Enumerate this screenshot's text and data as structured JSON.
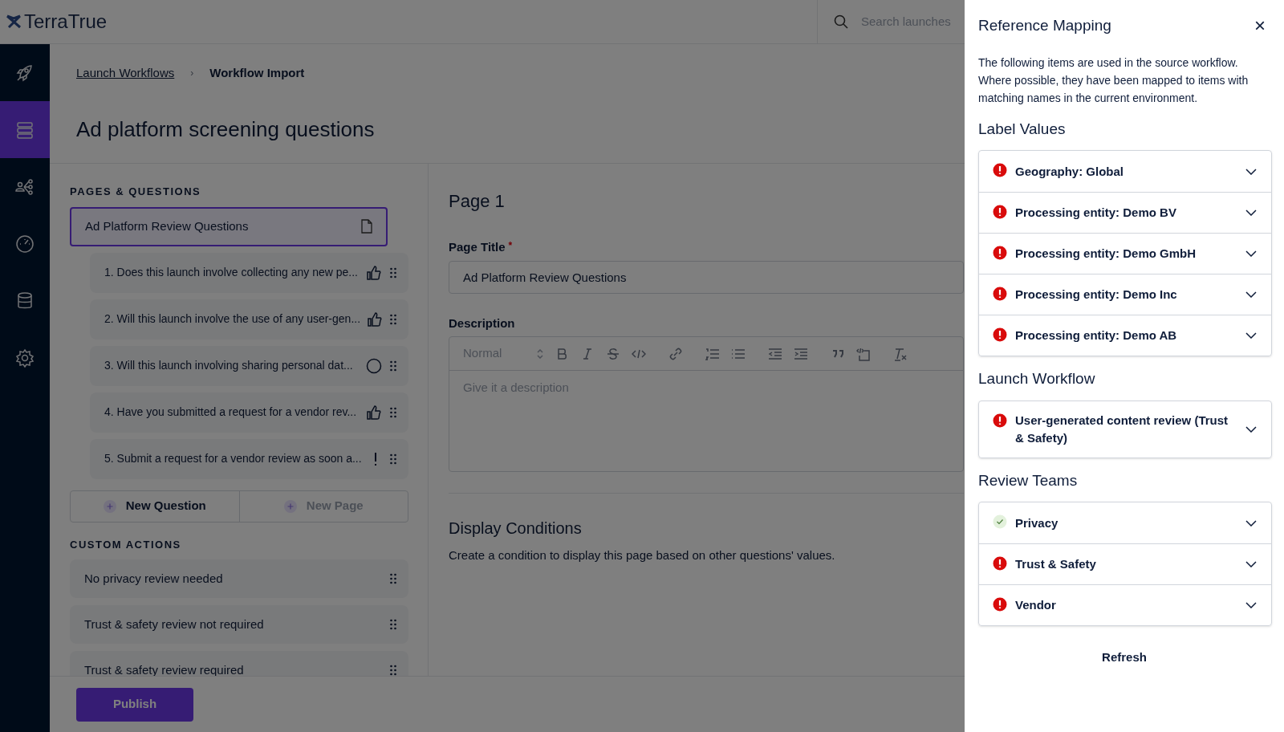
{
  "header": {
    "logo": "TerraTrue",
    "search": {
      "placeholder": "Search launches"
    }
  },
  "sidebar": {
    "items": [
      {
        "kind": "rocket",
        "selected": false
      },
      {
        "kind": "stack",
        "selected": true
      },
      {
        "kind": "share",
        "selected": false
      },
      {
        "kind": "gauge",
        "selected": false
      },
      {
        "kind": "database",
        "selected": false
      },
      {
        "kind": "gear",
        "selected": false
      }
    ]
  },
  "breadcrumbs": [
    {
      "label": "Launch Workflows",
      "current": false
    },
    {
      "label": "›",
      "current": false
    },
    {
      "label": "Workflow Import",
      "current": true
    }
  ],
  "title": "Ad platform screening questions",
  "pages_and_questions": {
    "heading": "PAGES & QUESTIONS",
    "page": {
      "label": "Ad Platform Review Questions",
      "selected": true
    },
    "questions": [
      {
        "label": "1. Does this launch involve collecting any new pe...",
        "kind": "thumbs-up"
      },
      {
        "label": "2. Will this launch involve the use of any user-gen...",
        "kind": "thumbs-up"
      },
      {
        "label": "3. Will this launch involving sharing personal dat...",
        "kind": "circle"
      },
      {
        "label": "4. Have you submitted a request for a vendor rev...",
        "kind": "thumbs-up"
      },
      {
        "label": "5. Submit a request for a vendor review as soon a...",
        "kind": "exclamation"
      }
    ],
    "buttons": [
      {
        "label": "New Question",
        "disabled": false
      },
      {
        "label": "New Page",
        "disabled": true
      }
    ]
  },
  "custom_actions": {
    "heading": "CUSTOM ACTIONS",
    "items": [
      "No privacy review needed",
      "Trust & safety review not required",
      "Trust & safety review required"
    ]
  },
  "publish_button": "Publish",
  "page_editor": {
    "heading": "Page 1",
    "page_title": {
      "label": "Page Title",
      "required": "*",
      "value": "Ad Platform Review Questions"
    },
    "description": {
      "label": "Description",
      "format": "Normal",
      "placeholder": "Give it a description"
    },
    "display_conditions": {
      "heading": "Display Conditions",
      "text": "Create a condition to display this page based on other questions' values."
    }
  },
  "drawer": {
    "title": "Reference Mapping",
    "close": "×",
    "intro": "The following items are used in the source workflow. Where possible, they have been mapped to items with matching names in the current environment.",
    "sections": [
      {
        "heading": "Label Values",
        "items": [
          {
            "label": "Geography: Global",
            "mapped": false
          },
          {
            "label": "Processing entity: Demo BV",
            "mapped": false
          },
          {
            "label": "Processing entity: Demo GmbH",
            "mapped": false
          },
          {
            "label": "Processing entity: Demo Inc",
            "mapped": false
          },
          {
            "label": "Processing entity: Demo AB",
            "mapped": false
          }
        ]
      },
      {
        "heading": "Launch Workflow",
        "items": [
          {
            "label": "User-generated content review (Trust & Safety)",
            "mapped": false
          }
        ]
      },
      {
        "heading": "Review Teams",
        "items": [
          {
            "label": "Privacy",
            "mapped": true
          },
          {
            "label": "Trust & Safety",
            "mapped": false
          },
          {
            "label": "Vendor",
            "mapped": false
          }
        ]
      }
    ],
    "refresh": "Refresh"
  }
}
